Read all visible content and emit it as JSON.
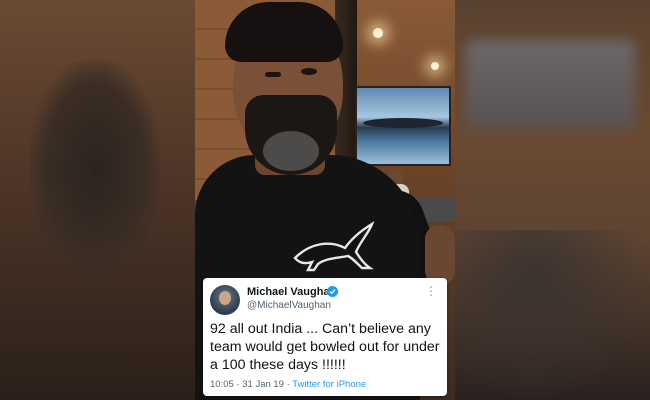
{
  "tweet": {
    "author_name": "Michael Vaughan",
    "author_handle": "@MichaelVaughan",
    "verified_icon": "verified-badge-icon",
    "text": "92 all out India ... Can’t believe any team would get bowled out for under a 100 these days !!!!!!",
    "time": "10:05",
    "date": "31 Jan 19",
    "separator": "·",
    "source": "Twitter for iPhone",
    "more_label": "⋮"
  },
  "colors": {
    "verified": "#1d9bf0",
    "text": "#0f1419",
    "muted": "#536471",
    "link": "#1d9bf0"
  }
}
